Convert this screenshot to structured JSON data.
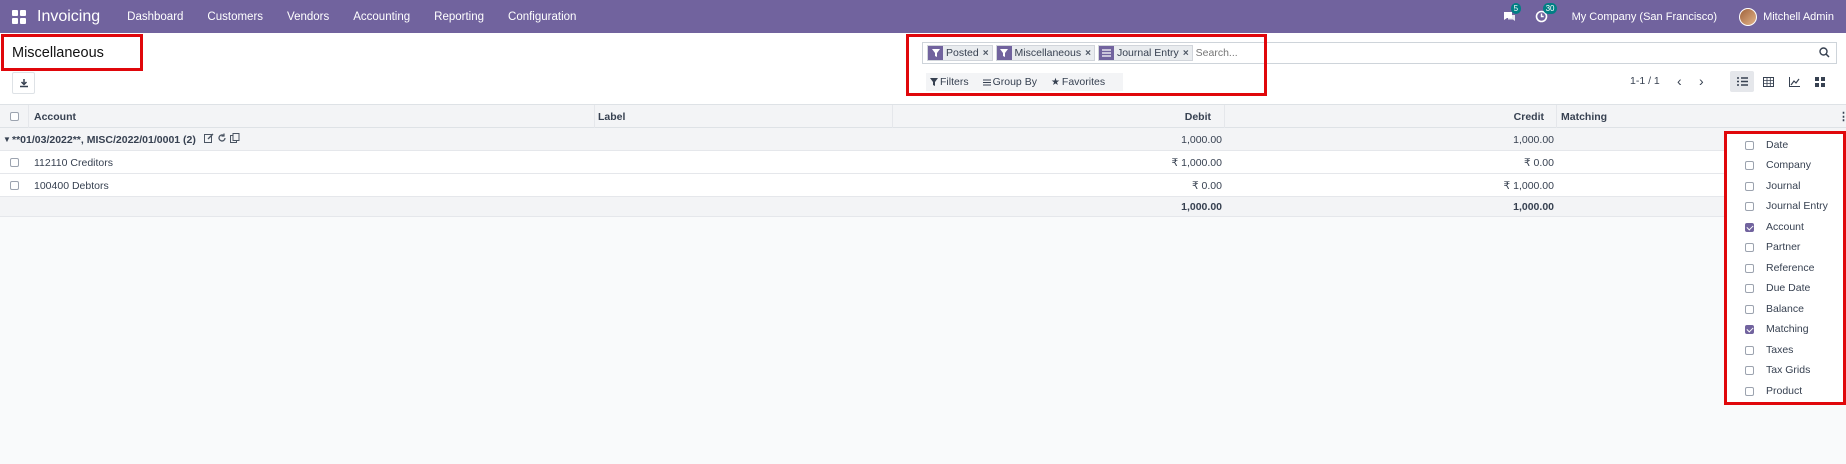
{
  "nav": {
    "app_title": "Invoicing",
    "menu": [
      "Dashboard",
      "Customers",
      "Vendors",
      "Accounting",
      "Reporting",
      "Configuration"
    ],
    "messages_count": "5",
    "activities_count": "30",
    "company": "My Company (San Francisco)",
    "user": "Mitchell Admin"
  },
  "control_panel": {
    "title": "Miscellaneous",
    "facets": [
      {
        "icon": "filter-icon",
        "label": "Posted"
      },
      {
        "icon": "filter-icon",
        "label": "Miscellaneous"
      },
      {
        "icon": "group-by-icon",
        "label": "Journal Entry"
      }
    ],
    "search_placeholder": "Search...",
    "filters_label": "Filters",
    "groupby_label": "Group By",
    "favorites_label": "Favorites",
    "pager": "1-1 / 1"
  },
  "table": {
    "headers": {
      "account": "Account",
      "label": "Label",
      "debit": "Debit",
      "credit": "Credit",
      "matching": "Matching"
    },
    "group": {
      "title": "**01/03/2022**, MISC/2022/01/0001 (2)",
      "debit": "1,000.00",
      "credit": "1,000.00"
    },
    "rows": [
      {
        "account": "112110 Creditors",
        "debit": "₹ 1,000.00",
        "credit": "₹ 0.00"
      },
      {
        "account": "100400 Debtors",
        "debit": "₹ 0.00",
        "credit": "₹ 1,000.00"
      }
    ],
    "totals": {
      "debit": "1,000.00",
      "credit": "1,000.00"
    }
  },
  "optional_columns": [
    {
      "label": "Date",
      "checked": false
    },
    {
      "label": "Company",
      "checked": false
    },
    {
      "label": "Journal",
      "checked": false
    },
    {
      "label": "Journal Entry",
      "checked": false
    },
    {
      "label": "Account",
      "checked": true
    },
    {
      "label": "Partner",
      "checked": false
    },
    {
      "label": "Reference",
      "checked": false
    },
    {
      "label": "Due Date",
      "checked": false
    },
    {
      "label": "Balance",
      "checked": false
    },
    {
      "label": "Matching",
      "checked": true
    },
    {
      "label": "Taxes",
      "checked": false
    },
    {
      "label": "Tax Grids",
      "checked": false
    },
    {
      "label": "Product",
      "checked": false
    }
  ],
  "colors": {
    "brand": "#71639e",
    "highlight": "#e0070b",
    "badge": "#017e84"
  }
}
